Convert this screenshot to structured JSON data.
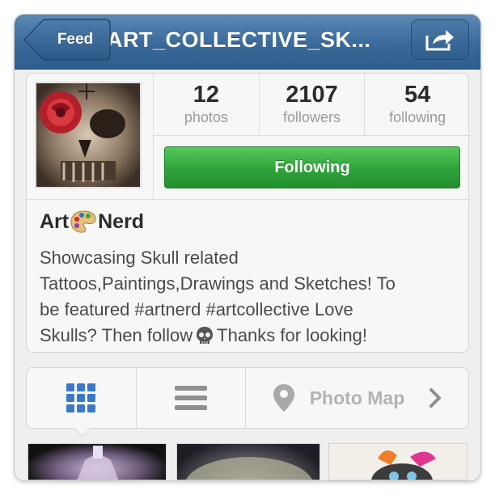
{
  "header": {
    "back_label": "Feed",
    "title": "ART_COLLECTIVE_SK...",
    "share_icon": "share-arrow-icon"
  },
  "profile": {
    "stats": [
      {
        "value": "12",
        "label": "photos"
      },
      {
        "value": "2107",
        "label": "followers"
      },
      {
        "value": "54",
        "label": "following"
      }
    ],
    "follow_button_label": "Following",
    "name_part1": "Art",
    "name_part2": "Nerd",
    "bio_line1": "Showcasing Skull related",
    "bio_line2": "Tattoos,Paintings,Drawings and Sketches! To",
    "bio_line3": "be featured #artnerd #artcollective Love",
    "bio_line4a": "Skulls? Then follow",
    "bio_line4b": "Thanks for looking!"
  },
  "view_bar": {
    "grid_icon": "grid-view-icon",
    "list_icon": "list-view-icon",
    "map_label": "Photo Map"
  },
  "colors": {
    "header_blue": "#3a6a9b",
    "follow_green": "#2ea23a"
  }
}
